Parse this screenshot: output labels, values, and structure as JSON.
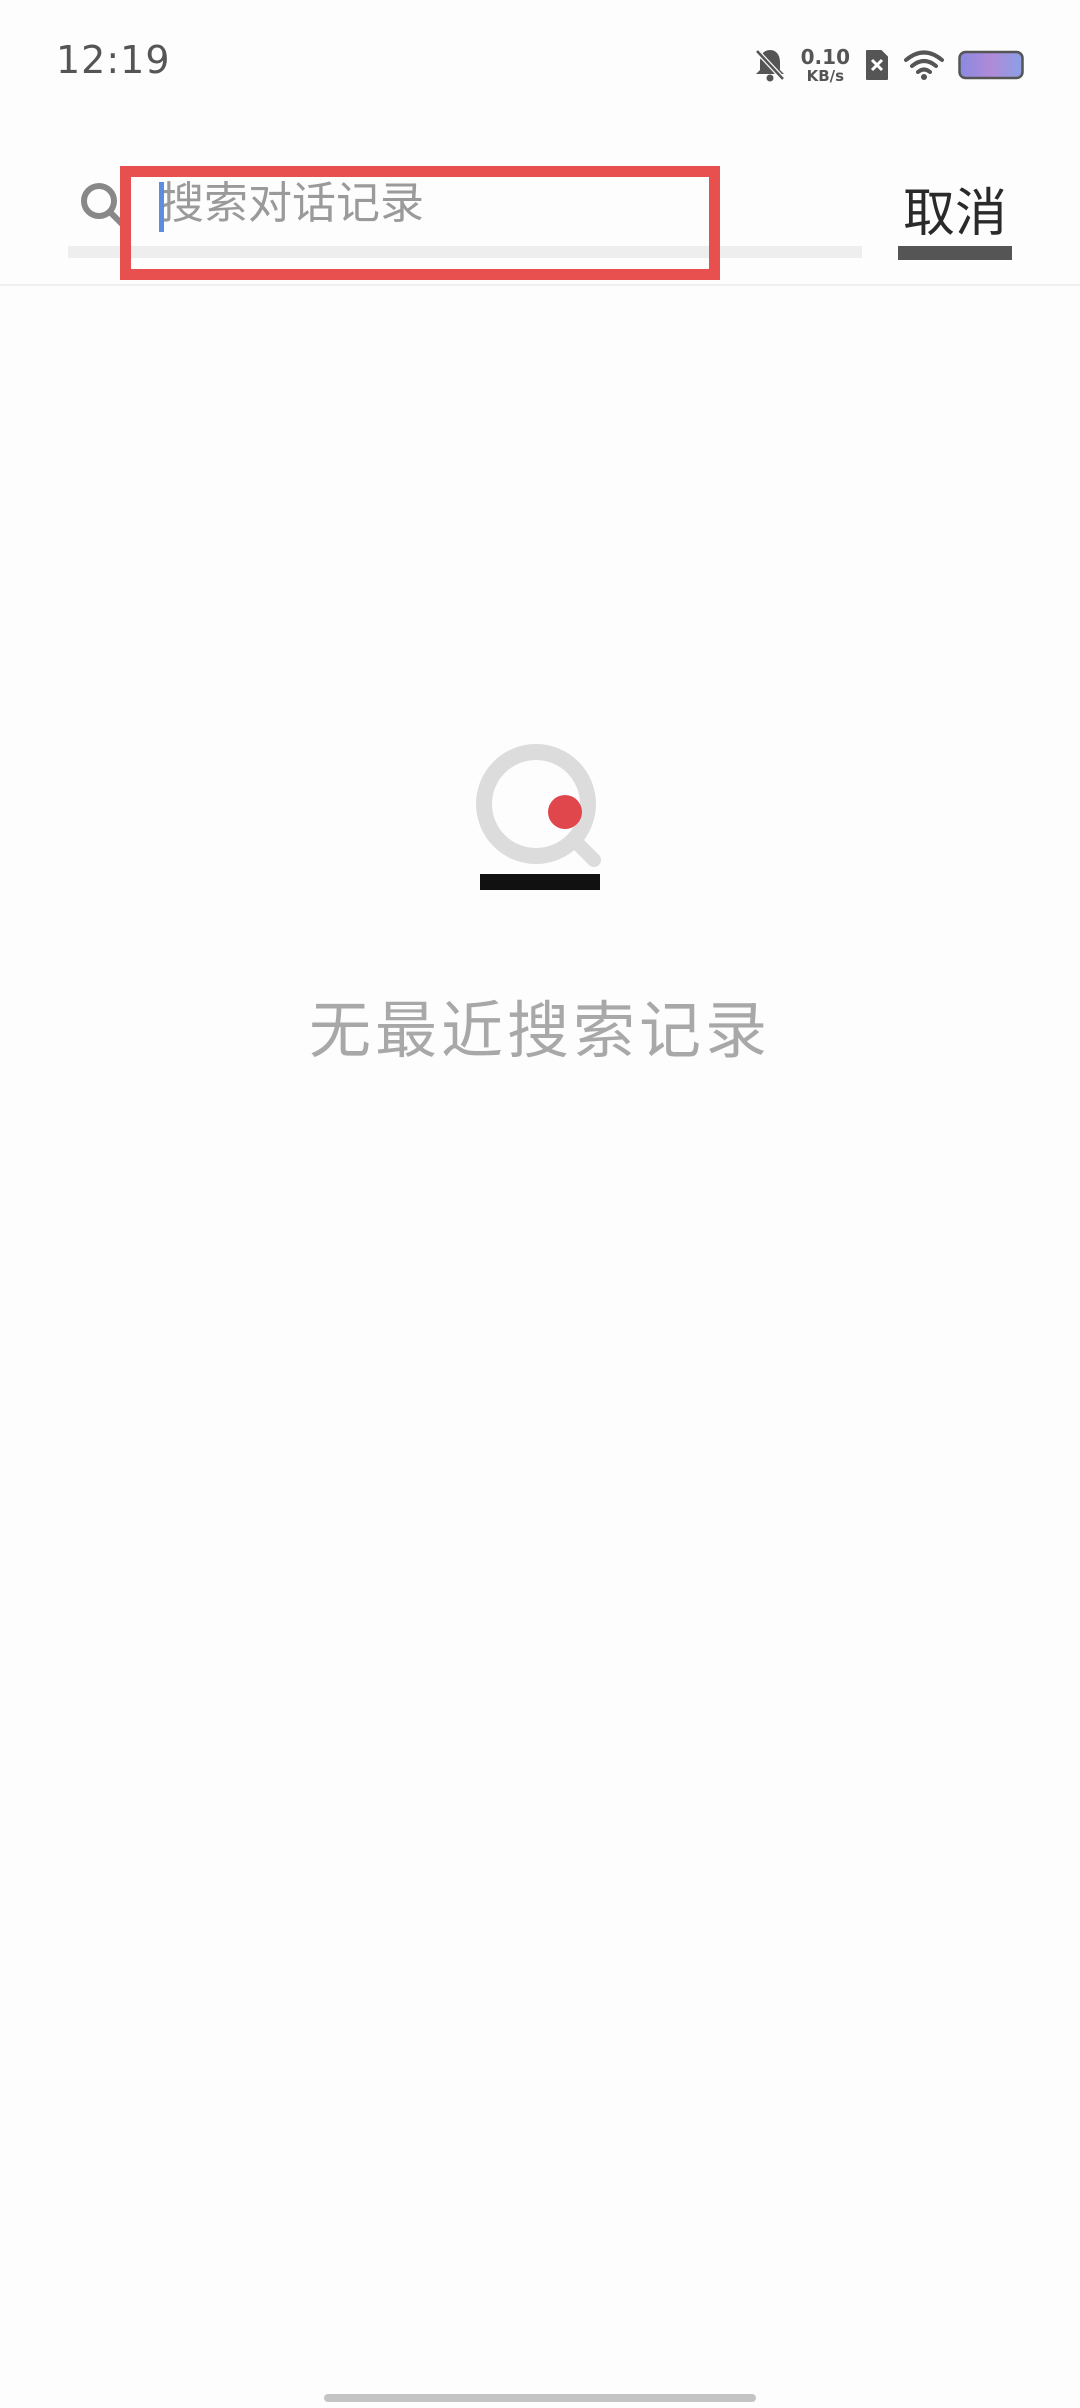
{
  "status_bar": {
    "time": "12:19",
    "net_speed_value": "0.10",
    "net_speed_unit": "KB/s",
    "icons": [
      "bell-muted-icon",
      "sim-off-icon",
      "wifi-icon",
      "battery-icon"
    ]
  },
  "search": {
    "placeholder": "搜索对话记录",
    "value": "",
    "cancel_label": "取消",
    "icon": "search-icon"
  },
  "empty_state": {
    "icon": "search-empty-icon",
    "message": "无最近搜索记录"
  },
  "colors": {
    "accent_red": "#e8504f",
    "caret_blue": "#5b8ee0",
    "muted_text": "#a8a8a8"
  }
}
